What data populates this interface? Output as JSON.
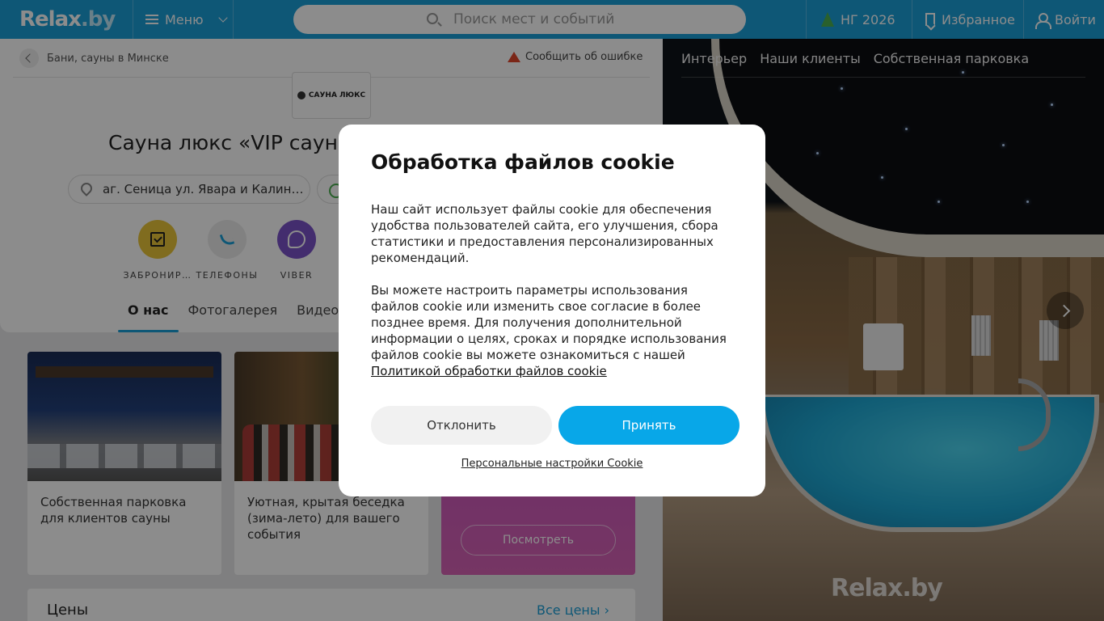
{
  "header": {
    "logo_text": "Relax",
    "logo_suffix": ".by",
    "menu_label": "Меню",
    "search_placeholder": "Поиск мест и событий",
    "ny_label": "НГ 2026",
    "favorites_label": "Избранное",
    "login_label": "Войти",
    "colors": {
      "bg": "#1b9fd8",
      "accent": "#08a7e8"
    }
  },
  "breadcrumb": {
    "label": "Бани, сауны в Минске"
  },
  "report_label": "Сообщить об ошибке",
  "brand_logo_text": "САУНА ЛЮКС",
  "place": {
    "title": "Сауна люкс «VIP сауна",
    "address": "аг. Сеница ул. Явара и Калин…"
  },
  "actions": [
    {
      "label": "ЗАБРОНИР…",
      "icon": "calendar-check-icon",
      "color": "#e9c53a"
    },
    {
      "label": "ТЕЛЕФОНЫ",
      "icon": "phone-icon",
      "color": "#ececec"
    },
    {
      "label": "VIBER",
      "icon": "viber-icon",
      "color": "#7b52c9"
    }
  ],
  "tabs": [
    {
      "label": "О нас"
    },
    {
      "label": "Фотогалерея"
    },
    {
      "label": "Видео"
    }
  ],
  "tiles": [
    {
      "caption": "Собственная парковка для клиентов сауны"
    },
    {
      "caption": "Уютная, крытая беседка (зима-лето) для вашего события"
    }
  ],
  "promo": {
    "button_label": "Посмотреть"
  },
  "prices": {
    "heading": "Цены",
    "all_label": "Все цены"
  },
  "gallery": {
    "tabs": [
      "Интерьер",
      "Наши клиенты",
      "Собственная парковка"
    ],
    "watermark": "Relax.by"
  },
  "cookie_modal": {
    "title": "Обработка файлов cookie",
    "paragraph1": "Наш сайт использует файлы cookie для обеспечения удобства пользователей сайта, его улучшения, сбора статистики и предоставления персонализированных рекомендаций.",
    "paragraph2": "Вы можете настроить параметры использования файлов cookie или изменить свое согласие в более позднее время. Для получения дополнительной информации о целях, сроках и порядке использования файлов cookie вы можете ознакомиться с нашей",
    "policy_link": "Политикой обработки файлов cookie",
    "decline_label": "Отклонить",
    "accept_label": "Принять",
    "personal_settings_label": "Персональные настройки Cookie"
  }
}
